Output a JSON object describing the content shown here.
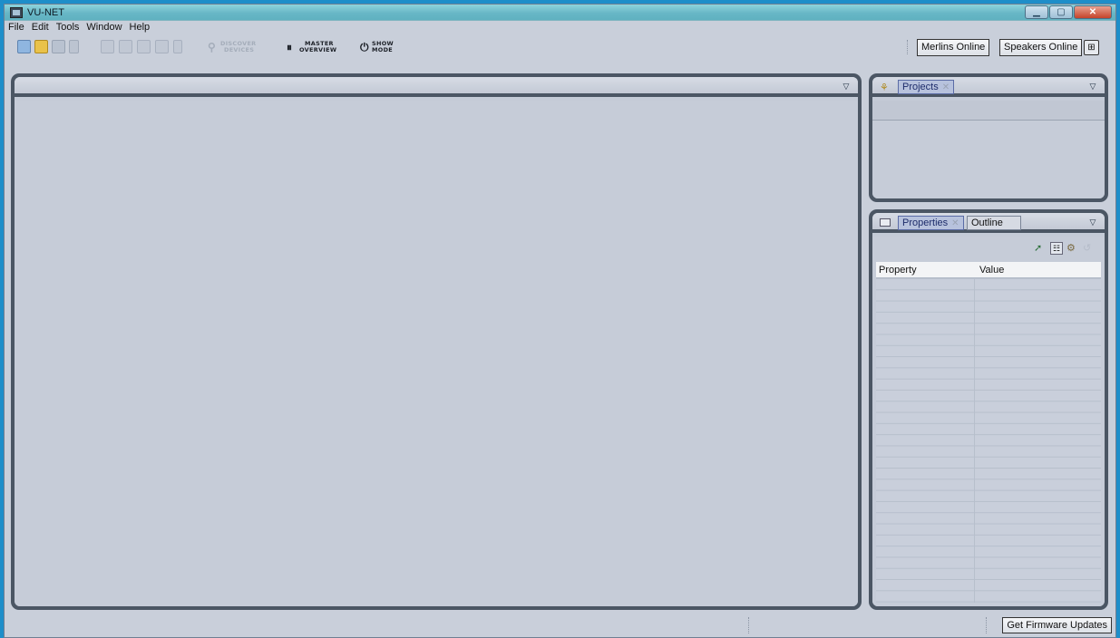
{
  "window": {
    "title": "VU-NET",
    "controls": [
      "minimize-icon",
      "maximize-icon",
      "close-icon"
    ]
  },
  "menu": [
    "File",
    "Edit",
    "Tools",
    "Window",
    "Help"
  ],
  "toolbar": {
    "icons": [
      "new-file-icon",
      "open-folder-icon",
      "save-icon",
      "save-all-icon",
      "align-left-icon",
      "align-center-icon",
      "distribute-icon",
      "group-icon",
      "ungroup-icon"
    ],
    "discover": {
      "line1": "DISCOVER",
      "line2": "DEVICES",
      "icon": "discover-devices-icon"
    },
    "master": {
      "line1": "MASTER",
      "line2": "OVERVIEW",
      "icon": "master-overview-icon"
    },
    "show": {
      "line1": "SHOW",
      "line2": "MODE",
      "icon": "show-mode-icon"
    },
    "merlins_online": "Merlins Online",
    "speakers_online": "Speakers Online",
    "network_icon": "network-icon"
  },
  "projects_panel": {
    "tab_label": "Projects",
    "icon": "projects-tree-icon"
  },
  "properties_panel": {
    "tabs": [
      "Properties",
      "Outline"
    ],
    "icon": "properties-view-icon",
    "toolbar_icons": [
      "pin-icon",
      "categories-icon",
      "filter-icon",
      "restore-icon"
    ],
    "columns": [
      "Property",
      "Value"
    ]
  },
  "status": {
    "firmware_button": "Get Firmware Updates"
  },
  "colors": {
    "titlebar": "#68b7c6",
    "window_bg": "#c9cfda",
    "panel_frame": "#4b5664",
    "tab_active": "#b7c2dd"
  }
}
